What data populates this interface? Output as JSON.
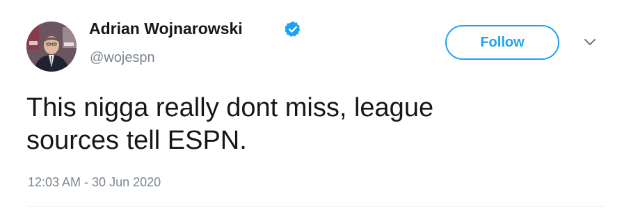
{
  "user": {
    "display_name": "Adrian Wojnarowski",
    "handle": "@wojespn",
    "verified": true
  },
  "follow_button": {
    "label": "Follow"
  },
  "tweet": {
    "text_lines": [
      "This nigga really dont miss, league",
      "sources tell ESPN."
    ],
    "timestamp": "12:03 AM - 30 Jun 2020"
  },
  "icons": {
    "verified": "verified-badge-icon",
    "menu": "chevron-down-icon"
  },
  "colors": {
    "accent": "#1da1f2",
    "text": "#14171a",
    "muted": "#7a8590"
  }
}
